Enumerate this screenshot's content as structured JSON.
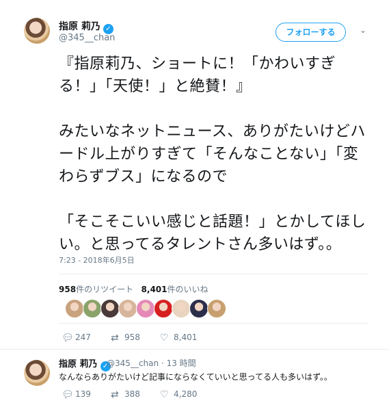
{
  "tweet": {
    "display_name": "指原 莉乃",
    "handle": "@345__chan",
    "follow_label": "フォローする",
    "text_lines": [
      "『指原莉乃、ショートに！「かわいすぎる！」「天使！」と絶賛！』",
      "みたいなネットニュース、ありがたいけどハードル上がりすぎて「そんなことない」「変わらずブス」になるので",
      "「そこそこいい感じと話題！」とかしてほしい。と思ってるタレントさん多いはず。。"
    ],
    "timestamp": "7:23 - 2018年6月5日",
    "retweet_count": "958",
    "retweet_label": "件のリツイート",
    "like_count": "8,401",
    "like_label": "件のいいね",
    "actions": {
      "reply": "247",
      "retweet": "958",
      "like": "8,401"
    }
  },
  "likers": [
    "#c9a27e",
    "#8aa36b",
    "#4b3a3a",
    "#d7b59a",
    "#e58ab8",
    "#d62020",
    "#e8d4c0",
    "#2c2f4a",
    "#c8a070"
  ],
  "reply": {
    "display_name": "指原 莉乃",
    "handle": "@345__chan",
    "separator": "·",
    "time": "13 時間",
    "text": "なんならありがたいけど記事にならなくていいと思ってる人も多いはず。。",
    "actions": {
      "reply": "139",
      "retweet": "388",
      "like": "4,280"
    }
  },
  "icons": {
    "verified": "verified-badge-icon",
    "reply": "reply-icon",
    "retweet": "retweet-icon",
    "like": "heart-icon",
    "caret": "chevron-down-icon"
  },
  "colors": {
    "accent": "#1da1f2",
    "text": "#14171a",
    "muted": "#657786"
  }
}
